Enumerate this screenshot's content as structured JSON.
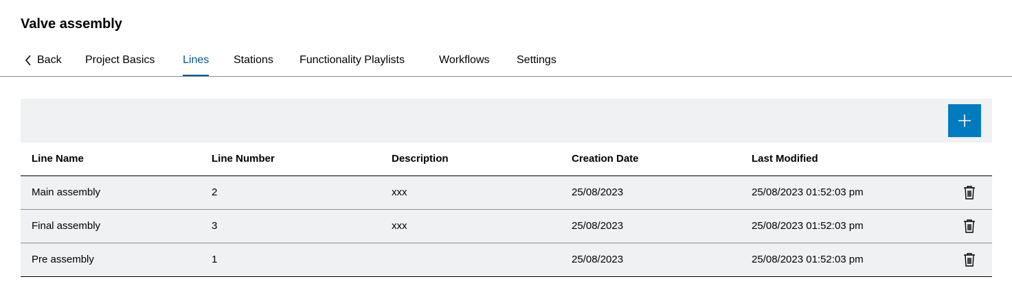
{
  "header": {
    "title": "Valve assembly"
  },
  "nav": {
    "back_label": "Back",
    "tabs": [
      {
        "label": "Project Basics"
      },
      {
        "label": "Lines"
      },
      {
        "label": "Stations"
      },
      {
        "label": "Functionality Playlists"
      },
      {
        "label": "Workflows"
      },
      {
        "label": "Settings"
      }
    ],
    "active_tab": "Lines"
  },
  "toolbar": {
    "add_icon": "plus-icon"
  },
  "table": {
    "columns": [
      "Line Name",
      "Line Number",
      "Description",
      "Creation Date",
      "Last Modified"
    ],
    "rows": [
      {
        "name": "Main assembly",
        "number": "2",
        "description": "xxx",
        "created": "25/08/2023",
        "modified": "25/08/2023 01:52:03 pm",
        "action_icon": "trash-icon"
      },
      {
        "name": "Final assembly",
        "number": "3",
        "description": "xxx",
        "created": "25/08/2023",
        "modified": "25/08/2023 01:52:03 pm",
        "action_icon": "trash-icon"
      },
      {
        "name": "Pre assembly",
        "number": "1",
        "description": "",
        "created": "25/08/2023",
        "modified": "25/08/2023 01:52:03 pm",
        "action_icon": "trash-icon"
      }
    ]
  },
  "colors": {
    "accent": "#005691",
    "button": "#007bc0",
    "surface": "#eff1f2"
  }
}
